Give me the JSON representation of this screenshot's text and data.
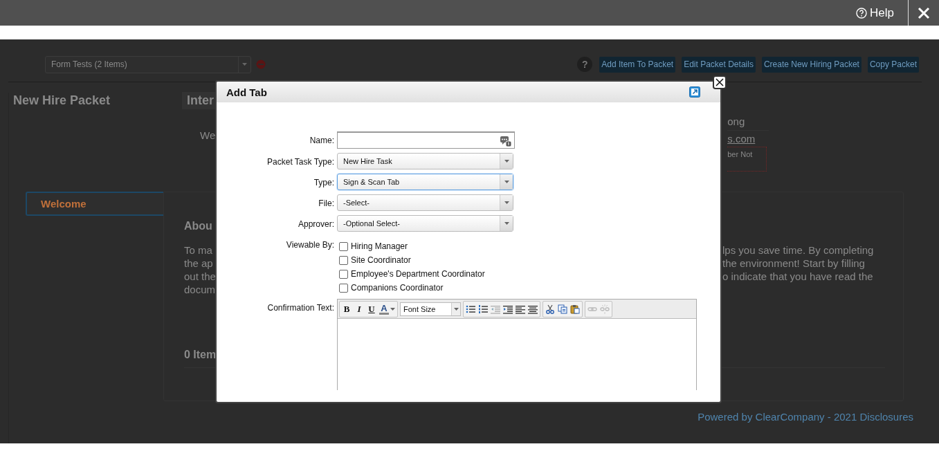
{
  "top_bar": {
    "help": "Help"
  },
  "page": {
    "packet_select": {
      "value": "Form Tests (2 Items)"
    },
    "help_glyph": "?",
    "buttons": [
      "Add Item To Packet",
      "Edit Packet Details",
      "Create New Hiring Packet",
      "Copy Packet"
    ],
    "title": "New Hire Packet",
    "tab_fragment": "Inter",
    "greeting_fragment": "We",
    "contact": {
      "name_fragment": "ong",
      "email_fragment": "s.com",
      "notice_fragment": "ber Not"
    },
    "side_tabs": [
      {
        "label": "Welcome",
        "selected": true
      }
    ],
    "section_heading_fragment": "Abou",
    "paragraph_rows": [
      {
        "left": "To ma",
        "right": "lps you save time. By completing"
      },
      {
        "left": "the ap",
        "right": "the environment! Start by filling"
      },
      {
        "left": "out the",
        "right": "o indicate that you have read the"
      },
      {
        "left": "docum"
      }
    ],
    "items_heading_fragment": "0 Item",
    "footer": "Powered by ClearCompany - 2021 Disclosures"
  },
  "dialog": {
    "title": "Add Tab",
    "fields": [
      {
        "kind": "text",
        "label": "Name:"
      },
      {
        "kind": "select",
        "label": "Packet Task Type:",
        "value": "New Hire Task",
        "focused": false
      },
      {
        "kind": "select",
        "label": "Type:",
        "value": "Sign & Scan Tab",
        "focused": true
      },
      {
        "kind": "select",
        "label": "File:",
        "value": "-Select-",
        "focused": false
      },
      {
        "kind": "select",
        "label": "Approver:",
        "value": "-Optional Select-",
        "focused": false
      },
      {
        "kind": "checks",
        "label": "Viewable By:",
        "options": [
          {
            "label": "Hiring Manager",
            "checked": false
          },
          {
            "label": "Site Coordinator",
            "checked": false
          },
          {
            "label": "Employee's Department Coordinator",
            "checked": false
          },
          {
            "label": "Companions Coordinator",
            "checked": false
          }
        ]
      },
      {
        "kind": "editor",
        "label": "Confirmation Text:",
        "format_buttons": [
          "B",
          "I",
          "U",
          "A"
        ],
        "font_size": "Font Size"
      }
    ]
  }
}
